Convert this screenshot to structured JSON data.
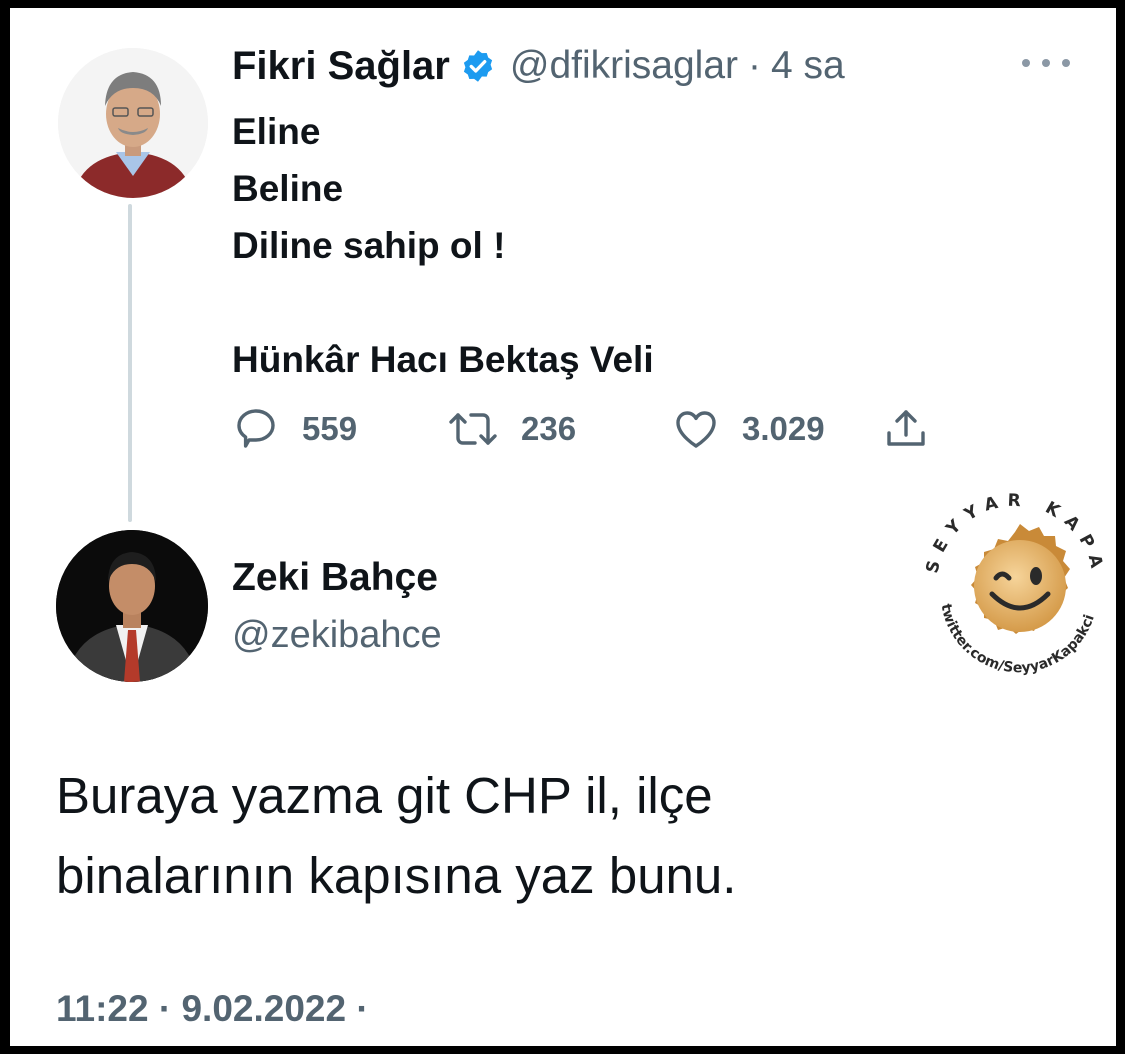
{
  "parent_tweet": {
    "author_name": "Fikri Sağlar",
    "author_handle": "@dfikrisaglar",
    "separator": "·",
    "time_ago": "4 sa",
    "text_lines": [
      "Eline",
      "Beline",
      "Diline sahip ol !",
      "",
      "Hünkâr Hacı Bektaş Veli"
    ],
    "stats": {
      "replies": "559",
      "retweets": "236",
      "likes": "3.029"
    },
    "verified": true
  },
  "reply_tweet": {
    "author_name": "Zeki Bahçe",
    "author_handle": "@zekibahce",
    "text_lines": [
      "Buraya yazma git CHP il, ilçe",
      "binalarının kapısına yaz bunu."
    ],
    "timestamp": "11:22 · 9.02.2022 ·"
  },
  "watermark": {
    "arc_text": "SEYYAR KAPAKÇI",
    "url_text": "twitter.com/SeyyarKapakci"
  },
  "colors": {
    "text_primary": "#0f1419",
    "text_secondary": "#536471",
    "verified_blue": "#1d9bf0",
    "thread_line": "#cfd9de"
  },
  "icons": [
    "verified-badge-icon",
    "more-options-icon",
    "reply-icon",
    "retweet-icon",
    "like-icon",
    "share-icon",
    "bottle-cap-smiley-icon"
  ]
}
